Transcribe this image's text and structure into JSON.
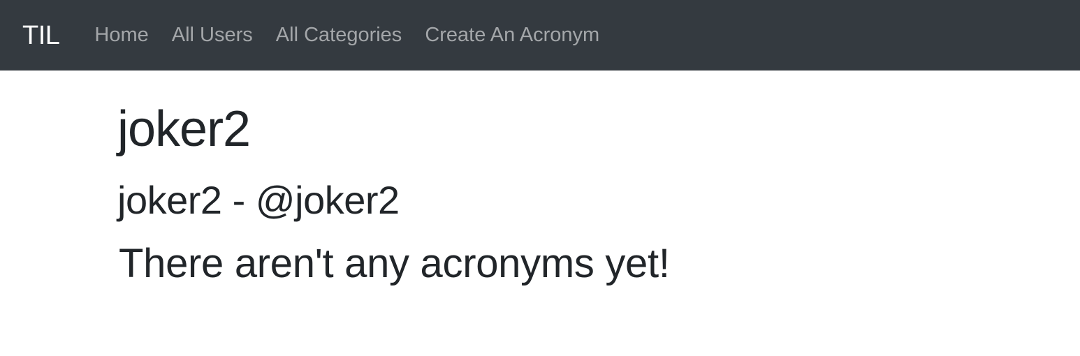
{
  "navbar": {
    "brand": "TIL",
    "links": [
      {
        "label": "Home"
      },
      {
        "label": "All Users"
      },
      {
        "label": "All Categories"
      },
      {
        "label": "Create An Acronym"
      }
    ],
    "background_color": "#343a40"
  },
  "user": {
    "name": "joker2",
    "subtitle": "joker2 - @joker2"
  },
  "acronyms": {
    "empty_message": "There aren't any acronyms yet!"
  }
}
